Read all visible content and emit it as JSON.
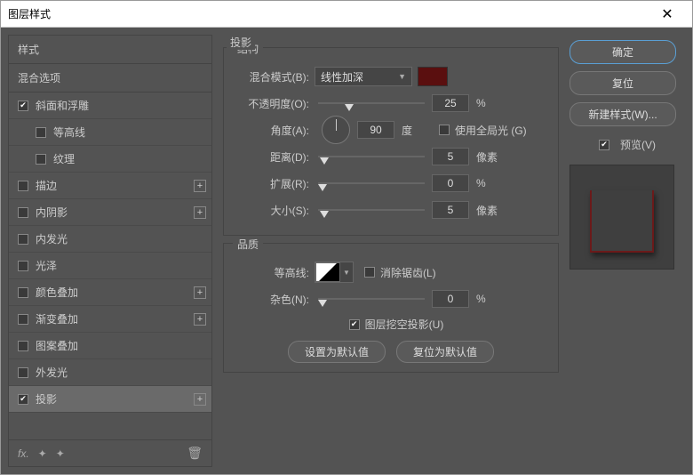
{
  "title": "图层样式",
  "sidebar": {
    "header": "样式",
    "blend": "混合选项",
    "items": [
      {
        "label": "斜面和浮雕",
        "checked": true,
        "plus": false,
        "sub": false
      },
      {
        "label": "等高线",
        "checked": false,
        "plus": false,
        "sub": true
      },
      {
        "label": "纹理",
        "checked": false,
        "plus": false,
        "sub": true
      },
      {
        "label": "描边",
        "checked": false,
        "plus": true,
        "sub": false
      },
      {
        "label": "内阴影",
        "checked": false,
        "plus": true,
        "sub": false
      },
      {
        "label": "内发光",
        "checked": false,
        "plus": false,
        "sub": false
      },
      {
        "label": "光泽",
        "checked": false,
        "plus": false,
        "sub": false
      },
      {
        "label": "颜色叠加",
        "checked": false,
        "plus": true,
        "sub": false
      },
      {
        "label": "渐变叠加",
        "checked": false,
        "plus": true,
        "sub": false
      },
      {
        "label": "图案叠加",
        "checked": false,
        "plus": false,
        "sub": false
      },
      {
        "label": "外发光",
        "checked": false,
        "plus": false,
        "sub": false
      },
      {
        "label": "投影",
        "checked": true,
        "plus": true,
        "sub": false,
        "active": true
      }
    ]
  },
  "main": {
    "section": "投影",
    "structure_label": "结构",
    "blend_mode_label": "混合模式(B):",
    "blend_mode_value": "线性加深",
    "opacity_label": "不透明度(O):",
    "opacity_value": "25",
    "angle_label": "角度(A):",
    "angle_value": "90",
    "degree": "度",
    "global_light": "使用全局光 (G)",
    "distance_label": "距离(D):",
    "distance_value": "5",
    "px": "像素",
    "spread_label": "扩展(R):",
    "spread_value": "0",
    "pct": "%",
    "size_label": "大小(S):",
    "size_value": "5",
    "quality_label": "品质",
    "contour_label": "等高线:",
    "antialias": "消除锯齿(L)",
    "noise_label": "杂色(N):",
    "noise_value": "0",
    "knockout": "图层挖空投影(U)",
    "set_default": "设置为默认值",
    "reset_default": "复位为默认值"
  },
  "right": {
    "ok": "确定",
    "cancel": "复位",
    "new_style": "新建样式(W)...",
    "preview": "预览(V)"
  },
  "colors": {
    "shadow": "#5a0f0f"
  }
}
